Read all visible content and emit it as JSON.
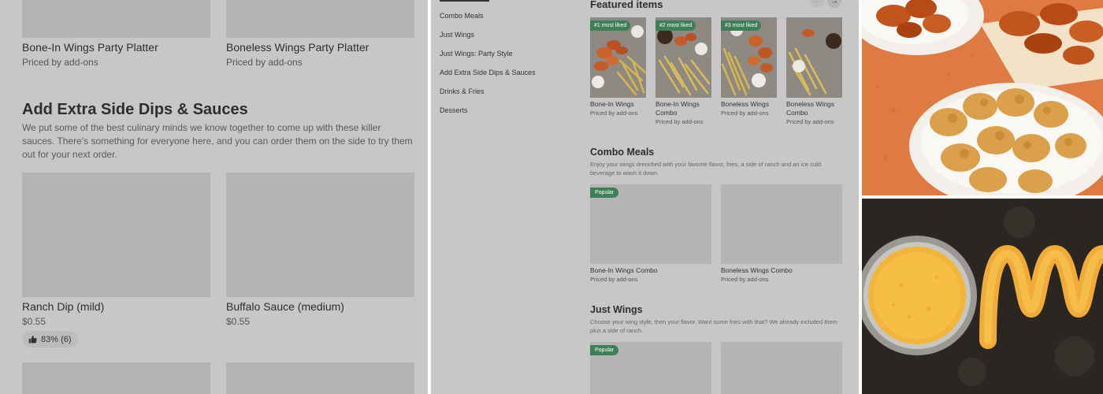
{
  "panel1": {
    "top_cards": [
      {
        "name": "Bone-In Wings Party Platter",
        "price": "Priced by add-ons"
      },
      {
        "name": "Boneless Wings Party Platter",
        "price": "Priced by add-ons"
      }
    ],
    "section": {
      "title": "Add Extra Side Dips & Sauces",
      "description": "We put some of the best culinary minds we know together to come up with these killer sauces. There's something for everyone here, and you can order them on the side to try them out for your next order."
    },
    "cards": [
      {
        "name": "Ranch Dip (mild)",
        "price": "$0.55",
        "rating": "83% (6)"
      },
      {
        "name": "Buffalo Sauce (medium)",
        "price": "$0.55"
      }
    ]
  },
  "panel2": {
    "nav": [
      "Combo Meals",
      "Just Wings",
      "Just Wings: Party Style",
      "Add Extra Side Dips & Sauces",
      "Drinks & Fries",
      "Desserts"
    ],
    "featured": {
      "title": "Featured items",
      "prev_icon": "arrow-left-icon",
      "next_icon": "arrow-right-icon",
      "prev_glyph": "←",
      "next_glyph": "→",
      "items": [
        {
          "badge": "#1 most liked",
          "name": "Bone-In Wings",
          "price": "Priced by add-ons"
        },
        {
          "badge": "#2 most liked",
          "name": "Bone-In Wings Combo",
          "price": "Priced by add-ons"
        },
        {
          "badge": "#3 most liked",
          "name": "Boneless Wings",
          "price": "Priced by add-ons"
        },
        {
          "badge": "",
          "name": "Boneless Wings Combo",
          "price": "Priced by add-ons"
        }
      ]
    },
    "combo": {
      "title": "Combo Meals",
      "description": "Enjoy your wings drenched with your favorite flavor, fries, a side of ranch and an ice cold beverage to wash it down.",
      "badge": "Popular",
      "items": [
        {
          "name": "Bone-In Wings Combo",
          "price": "Priced by add-ons"
        },
        {
          "name": "Boneless Wings Combo",
          "price": "Priced by add-ons"
        }
      ]
    },
    "just_wings": {
      "title": "Just Wings",
      "description": "Choose your wing style, then your flavor. Want some fries with that? We already included them plus a side of ranch.",
      "badge": "Popular"
    }
  },
  "colors": {
    "overlay_gray": "#c7c7c7",
    "placeholder_gray": "#b3b3b3",
    "badge_green": "#3d7f58",
    "orange_background": "#e07a43",
    "dark_background": "#2b2622"
  }
}
